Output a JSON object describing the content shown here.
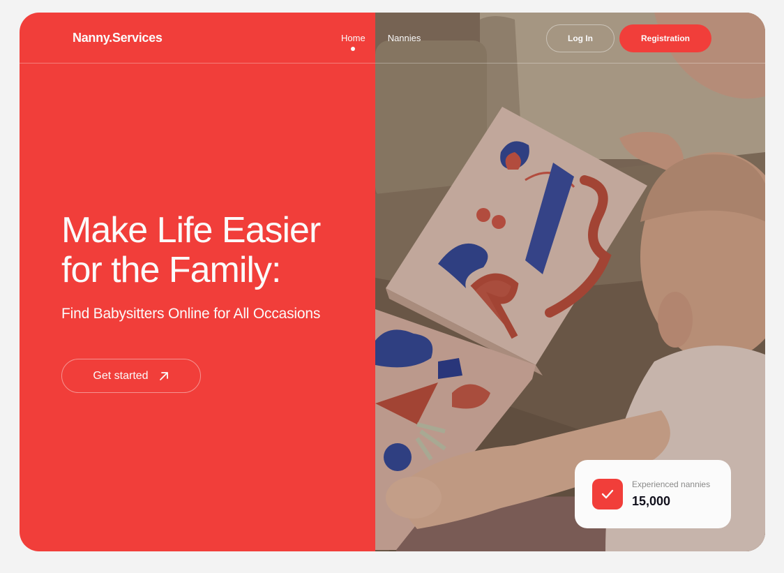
{
  "header": {
    "logo": "Nanny.Services",
    "nav": [
      {
        "label": "Home",
        "active": true
      },
      {
        "label": "Nannies",
        "active": false
      }
    ],
    "login_label": "Log In",
    "register_label": "Registration"
  },
  "hero": {
    "title_line1": "Make Life Easier",
    "title_line2": "for the Family:",
    "subtitle": "Find Babysitters Online for All Occasions",
    "cta_label": "Get started",
    "cta_icon": "arrow-up-right-icon"
  },
  "stats": {
    "label": "Experienced nannies",
    "value": "15,000",
    "icon": "check-icon"
  },
  "colors": {
    "accent": "#f13e3a",
    "text_light": "#fbfbfb",
    "text_dark": "#11101c"
  }
}
